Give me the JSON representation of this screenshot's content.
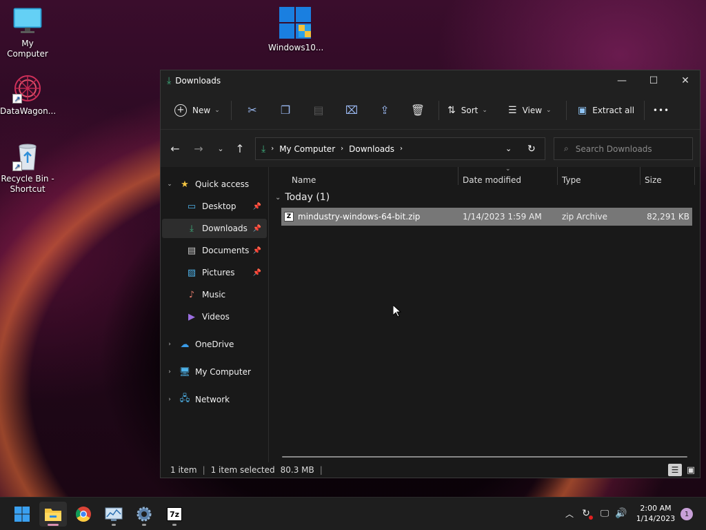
{
  "desktop": {
    "icons": [
      {
        "label": "My Computer"
      },
      {
        "label": "DataWagon..."
      },
      {
        "label": "Recycle Bin -\nShortcut"
      },
      {
        "label": "Windows10..."
      }
    ]
  },
  "window": {
    "title": "Downloads",
    "controls": {
      "minimize": "—",
      "maximize": "☐",
      "close": "✕"
    }
  },
  "toolbar": {
    "new_label": "New",
    "sort_label": "Sort",
    "view_label": "View",
    "extract_label": "Extract all",
    "more_label": "•••"
  },
  "address": {
    "crumbs": [
      "My Computer",
      "Downloads"
    ],
    "search_placeholder": "Search Downloads"
  },
  "sidebar": {
    "quick_access": "Quick access",
    "items": [
      {
        "label": "Desktop",
        "icon": "desktop-icon",
        "pinned": true
      },
      {
        "label": "Downloads",
        "icon": "download-icon",
        "pinned": true,
        "selected": true
      },
      {
        "label": "Documents",
        "icon": "document-icon",
        "pinned": true
      },
      {
        "label": "Pictures",
        "icon": "pictures-icon",
        "pinned": true
      },
      {
        "label": "Music",
        "icon": "music-icon",
        "pinned": false
      },
      {
        "label": "Videos",
        "icon": "video-icon",
        "pinned": false
      }
    ],
    "roots": [
      {
        "label": "OneDrive",
        "icon": "cloud-icon"
      },
      {
        "label": "My Computer",
        "icon": "computer-icon"
      },
      {
        "label": "Network",
        "icon": "network-icon"
      }
    ]
  },
  "content": {
    "columns": [
      "Name",
      "Date modified",
      "Type",
      "Size"
    ],
    "group_label": "Today (1)",
    "files": [
      {
        "name": "mindustry-windows-64-bit.zip",
        "date": "1/14/2023 1:59 AM",
        "type": "zip Archive",
        "size": "82,291 KB"
      }
    ]
  },
  "status": {
    "count": "1 item",
    "selected": "1 item selected",
    "size": "80.3 MB"
  },
  "taskbar": {
    "apps": [
      "start",
      "file-explorer",
      "chrome",
      "monitor",
      "settings",
      "7zip"
    ],
    "clock_time": "2:00 AM",
    "clock_date": "1/14/2023",
    "notification_count": "1",
    "seven_zip_label": "7z"
  },
  "colors": {
    "accent": "#0078d4",
    "download_green": "#3fb27f",
    "selected_row": "#777777",
    "folder_yellow": "#f4c542"
  }
}
